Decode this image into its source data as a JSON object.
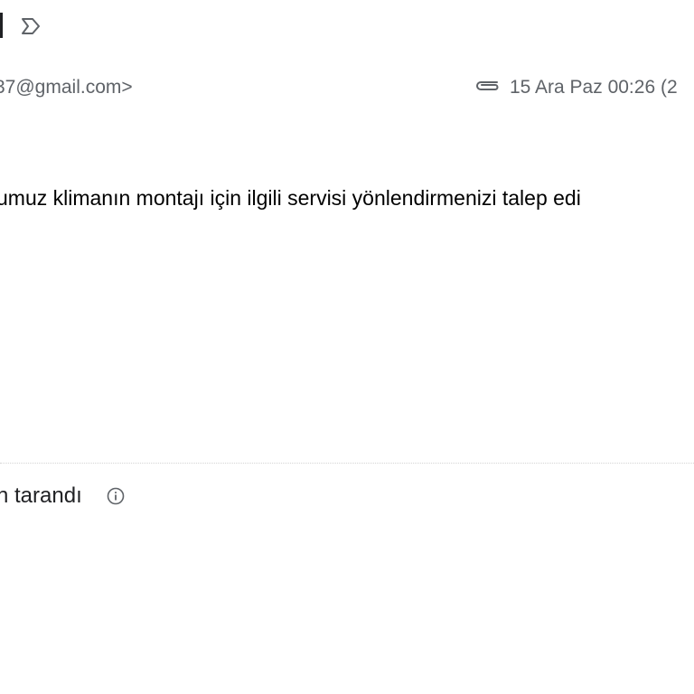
{
  "header": {
    "label_icon": "label-outline-icon"
  },
  "message": {
    "sender_email": "37@gmail.com>",
    "attachment_icon": "paperclip-icon",
    "date": "15 Ara Paz 00:26 (2",
    "body": "umuz klimanın montajı için ilgili servisi yönlendirmenizi talep edi"
  },
  "footer": {
    "scan_status": "n tarandı",
    "info_icon": "info-circle-icon"
  },
  "colors": {
    "text_primary": "#000000",
    "text_secondary": "#5f6368",
    "divider": "#d4d4d4",
    "background": "#ffffff"
  }
}
